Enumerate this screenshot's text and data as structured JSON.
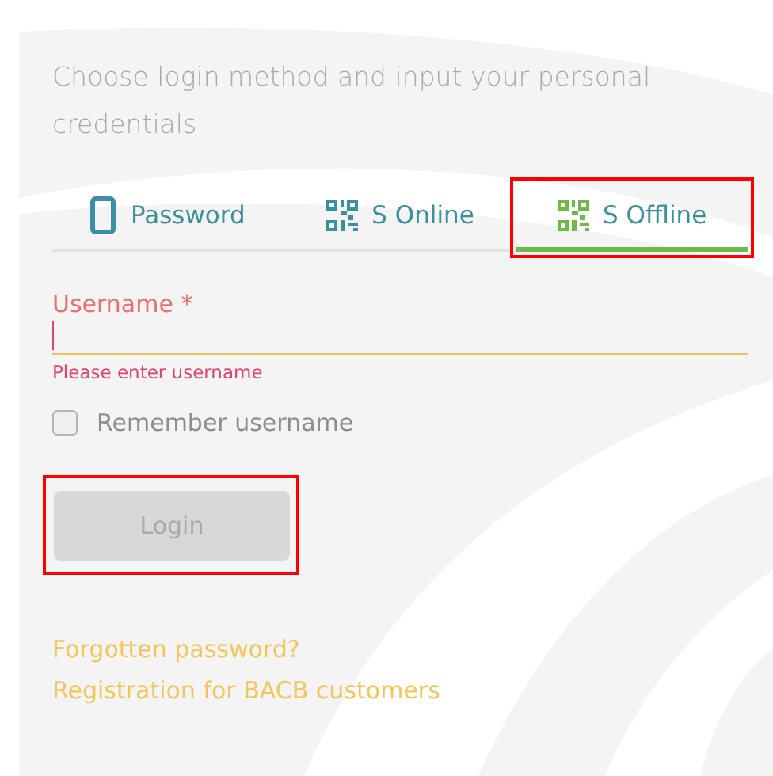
{
  "intro": "Choose login method and input your personal credentials",
  "tabs": [
    {
      "label": "Password",
      "kind": "phone",
      "selected": false,
      "highlighted": false
    },
    {
      "label": "S Online",
      "kind": "qr",
      "selected": false,
      "highlighted": false
    },
    {
      "label": "S Offline",
      "kind": "qr",
      "selected": true,
      "highlighted": true
    }
  ],
  "username": {
    "label": "Username *",
    "error": "Please enter username"
  },
  "remember": {
    "label": "Remember username",
    "checked": false
  },
  "login_button": {
    "label": "Login",
    "disabled": true,
    "highlighted": true
  },
  "links": [
    "Forgotten password?",
    "Registration for BACB customers"
  ]
}
